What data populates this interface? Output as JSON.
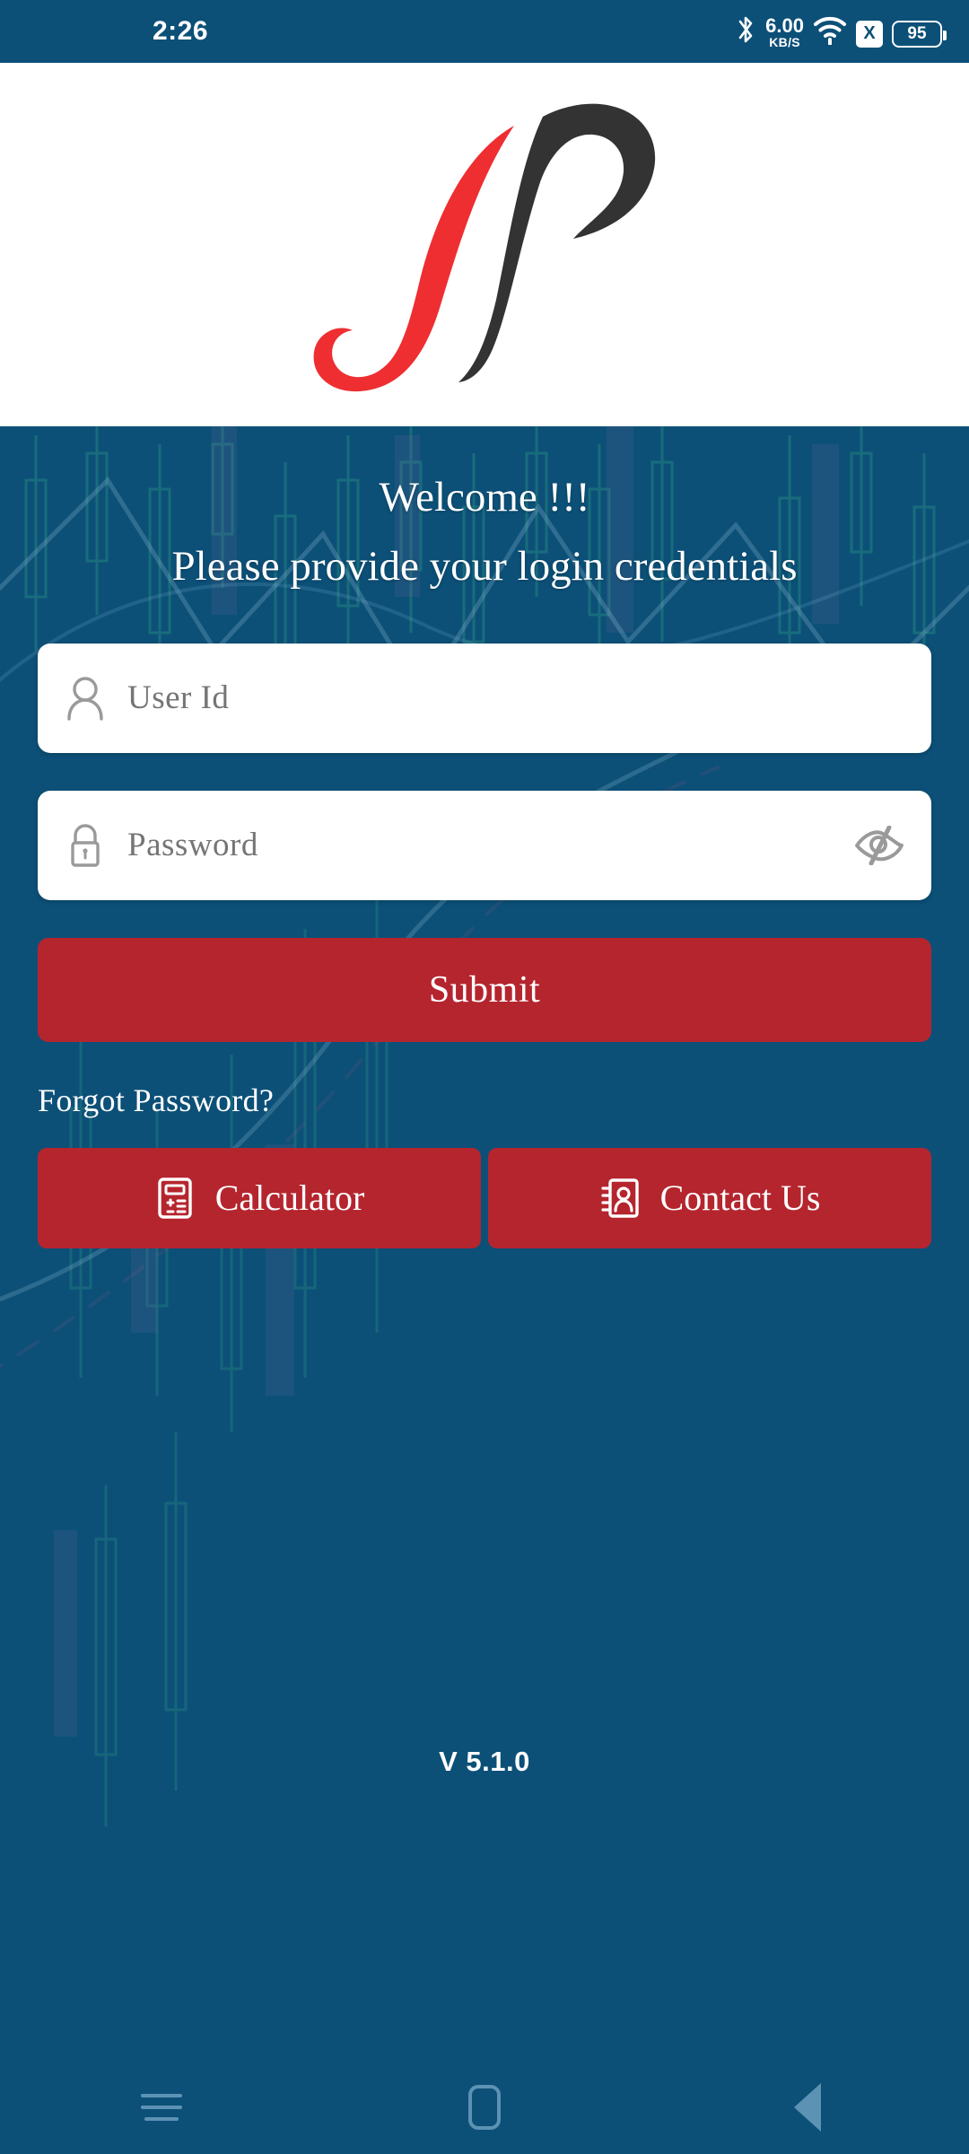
{
  "statusbar": {
    "time": "2:26",
    "bluetooth_icon": "bluetooth-icon",
    "net_speed_value": "6.00",
    "net_speed_unit": "KB/S",
    "wifi_icon": "wifi-icon",
    "sim_x_label": "X",
    "battery_level": "95"
  },
  "brand": {
    "logo_name": "jp-monogram-logo",
    "red": "#EE2E31",
    "dark": "#333333"
  },
  "header": {
    "welcome": "Welcome !!!",
    "subtitle": "Please provide your login credentials"
  },
  "form": {
    "user": {
      "icon": "person-icon",
      "value": "",
      "placeholder": "User Id"
    },
    "password": {
      "icon": "lock-icon",
      "value": "",
      "placeholder": "Password",
      "toggle_icon": "eye-slash-icon"
    },
    "submit_label": "Submit",
    "forgot_label": "Forgot Password?"
  },
  "actions": [
    {
      "label": "Calculator",
      "icon": "calculator-icon"
    },
    {
      "label": "Contact Us",
      "icon": "contact-book-icon"
    }
  ],
  "footer": {
    "version": "V 5.1.0"
  },
  "navbar": {
    "recents": "recents-icon",
    "home": "home-icon",
    "back": "back-icon"
  },
  "colors": {
    "brand_blue": "#0C5078",
    "brand_red": "#B5252E",
    "logo_red": "#EE2E31",
    "logo_dark": "#333333"
  }
}
